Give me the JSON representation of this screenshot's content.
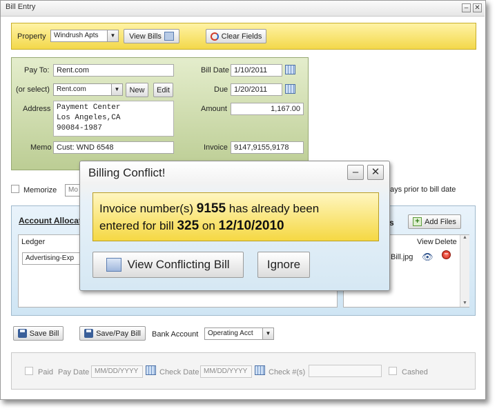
{
  "window": {
    "title": "Bill Entry"
  },
  "toolbar": {
    "property_label": "Property",
    "property_value": "Windrush Apts",
    "view_bills": "View Bills",
    "clear_fields": "Clear Fields"
  },
  "bill_form": {
    "pay_to_label": "Pay To:",
    "pay_to_value": "Rent.com",
    "or_select_label": "(or select)",
    "or_select_value": "Rent.com",
    "new_button": "New",
    "edit_button": "Edit",
    "address_label": "Address",
    "address_line1": "Payment Center",
    "address_line2": "Los Angeles,CA",
    "address_line3": "90084-1987",
    "memo_label": "Memo",
    "memo_value": "Cust: WND 6548",
    "bill_date_label": "Bill Date",
    "bill_date_value": "1/10/2011",
    "due_label": "Due",
    "due_value": "1/20/2011",
    "amount_label": "Amount",
    "amount_value": "1,167.00",
    "invoice_label": "Invoice",
    "invoice_value": "9147,9155,9178"
  },
  "memorize": {
    "label": "Memorize",
    "select_partial": "Mo",
    "days_text": "ays prior to bill date"
  },
  "allocation": {
    "title": "Account Allocat",
    "ledger_header": "Ledger",
    "ledger_value": "Advertising-Exp"
  },
  "files": {
    "heading_partial": "s",
    "add_files": "Add Files",
    "view_header": "View",
    "delete_header": "Delete",
    "file_name_partial": "Bill.jpg"
  },
  "actions": {
    "save_bill": "Save Bill",
    "save_pay_bill": "Save/Pay Bill",
    "bank_account_label": "Bank Account",
    "bank_account_value": "Operating Acct"
  },
  "payment": {
    "paid_label": "Paid",
    "pay_date_label": "Pay Date",
    "pay_date_placeholder": "MM/DD/YYYY",
    "check_date_label": "Check Date",
    "check_date_placeholder": "MM/DD/YYYY",
    "check_no_label": "Check #(s)",
    "cashed_label": "Cashed"
  },
  "dialog": {
    "title": "Billing Conflict!",
    "msg_part1": "Invoice number(s) ",
    "invoice_number": "9155",
    "msg_part2": " has already been",
    "msg_part3": "entered for bill ",
    "bill_number": "325",
    "msg_part4": " on ",
    "date": "12/10/2010",
    "view_conflicting_bill": "View Conflicting Bill",
    "ignore": "Ignore"
  },
  "colors": {
    "yellow_accent": "#f3d84a",
    "green_panel": "#bccd94",
    "blue_panel": "#cfe5f4"
  }
}
